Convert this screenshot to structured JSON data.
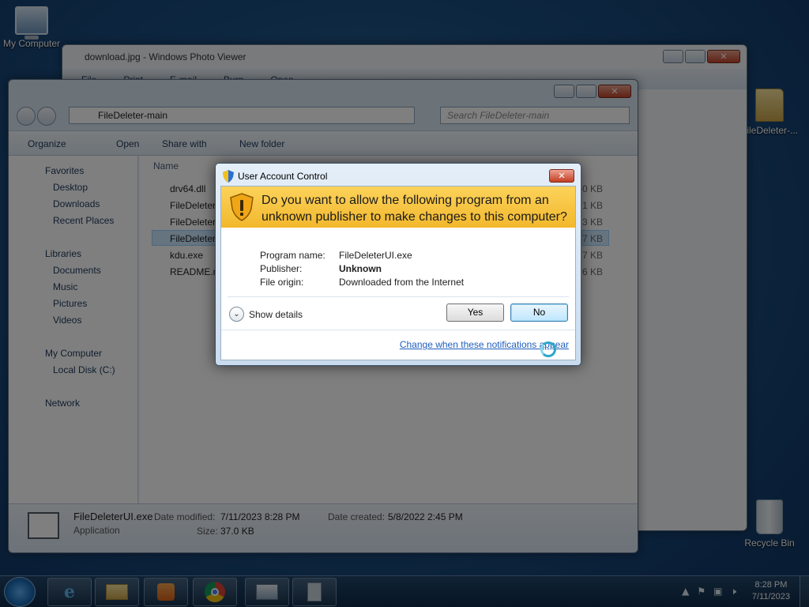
{
  "desktop": {
    "icons": [
      "My Computer",
      "FileDeleter-...",
      "Recycle Bin"
    ]
  },
  "photo_viewer": {
    "title": "download.jpg - Windows Photo Viewer",
    "menu": [
      "File",
      "Print",
      "E-mail",
      "Burn",
      "Open"
    ]
  },
  "explorer": {
    "address": "FileDeleter-main",
    "search_placeholder": "Search FileDeleter-main",
    "toolbar": {
      "organize": "Organize",
      "open": "Open",
      "share_with": "Share with",
      "new_folder": "New folder"
    },
    "column_name": "Name",
    "nav": {
      "favorites": "Favorites",
      "desktop": "Desktop",
      "downloads": "Downloads",
      "recent": "Recent Places",
      "libraries": "Libraries",
      "documents": "Documents",
      "music": "Music",
      "pictures": "Pictures",
      "videos": "Videos",
      "computer": "My Computer",
      "local_disk": "Local Disk (C:)",
      "network": "Network"
    },
    "files": [
      {
        "name": "drv64.dll",
        "size": "0 KB"
      },
      {
        "name": "FileDeleter.",
        "size": "1 KB"
      },
      {
        "name": "FileDeleterU",
        "size": "3 KB"
      },
      {
        "name": "FileDeleterU",
        "size": "7 KB"
      },
      {
        "name": "kdu.exe",
        "size": "7 KB"
      },
      {
        "name": "README.m",
        "size": "6 KB"
      }
    ],
    "details": {
      "filename": "FileDeleterUI.exe",
      "type": "Application",
      "modified_label": "Date modified:",
      "modified": "7/11/2023 8:28 PM",
      "size_label": "Size:",
      "size": "37.0 KB",
      "created_label": "Date created:",
      "created": "5/8/2022 2:45 PM"
    }
  },
  "uac": {
    "title": "User Account Control",
    "question": "Do you want to allow the following program from an unknown publisher to make changes to this computer?",
    "program_label": "Program name:",
    "program_value": "FileDeleterUI.exe",
    "publisher_label": "Publisher:",
    "publisher_value": "Unknown",
    "origin_label": "File origin:",
    "origin_value": "Downloaded from the Internet",
    "show_details": "Show details",
    "yes": "Yes",
    "no": "No",
    "link": "Change when these notifications appear"
  },
  "taskbar": {
    "time": "8:28 PM",
    "date": "7/11/2023"
  },
  "colors": {
    "banner": "#f2b82d",
    "link": "#1e5ebd",
    "desktop": "#1c4f82"
  }
}
